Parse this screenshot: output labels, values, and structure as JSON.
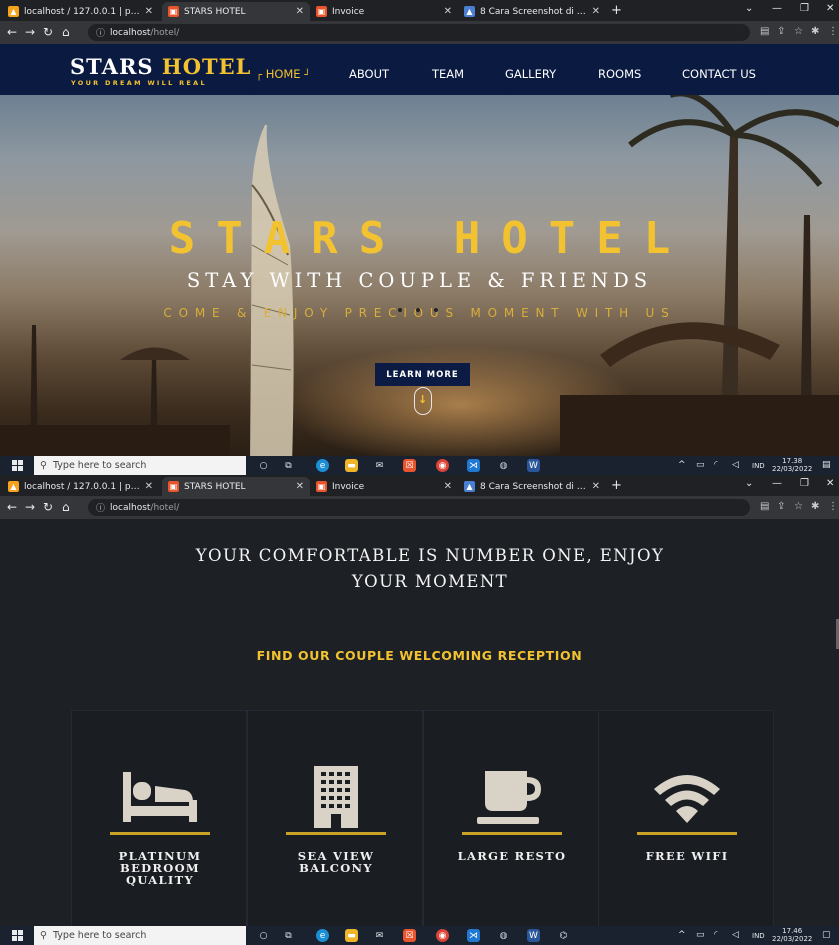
{
  "window1": {
    "tabs": [
      {
        "label": "localhost / 127.0.0.1 | phpMyAdmin",
        "favicon": "phpmyadmin-icon",
        "color": "#f7a21b",
        "active": false
      },
      {
        "label": "STARS HOTEL",
        "favicon": "hotel-icon",
        "color": "#e8542c",
        "active": true
      },
      {
        "label": "Invoice",
        "favicon": "hotel-icon",
        "color": "#e8542c",
        "active": false
      },
      {
        "label": "8 Cara Screenshot di Laptop Windows",
        "favicon": "article-icon",
        "color": "#4a7fd4",
        "active": false
      }
    ],
    "url_host": "localhost",
    "url_path": "/hotel/"
  },
  "hotel": {
    "brand_main": "STARS",
    "brand_accent": "HOTEL",
    "tagline": "YOUR DREAM WILL REAL",
    "nav": [
      "HOME",
      "ABOUT",
      "TEAM",
      "GALLERY",
      "ROOMS",
      "CONTACT US"
    ],
    "hero_title": "STARS HOTEL",
    "hero_subtitle": "STAY WITH COUPLE & FRIENDS",
    "hero_tagline": "COME & ENJOY PRECIOUS MOMENT WITH US",
    "cta": "LEARN MORE",
    "scroll_arrow": "↓"
  },
  "taskbar1": {
    "search_placeholder": "Type here to search",
    "lang": "IND",
    "time": "17.38",
    "date": "22/03/2022"
  },
  "taskbar2": {
    "search_placeholder": "Type here to search",
    "lang": "IND",
    "time": "17.46",
    "date": "22/03/2022"
  },
  "section2": {
    "title": "YOUR COMFORTABLE IS NUMBER ONE, ENJOY YOUR MOMENT",
    "subtitle": "FIND OUR COUPLE WELCOMING RECEPTION",
    "features": [
      {
        "label": "PLATINUM BEDROOM QUALITY",
        "icon": "bed-icon"
      },
      {
        "label": "SEA VIEW BALCONY",
        "icon": "building-icon"
      },
      {
        "label": "LARGE RESTO",
        "icon": "coffee-cup-icon"
      },
      {
        "label": "FREE WIFI",
        "icon": "wifi-icon"
      }
    ]
  },
  "colors": {
    "gold": "#f2c230",
    "navy": "#0a1a40",
    "dark": "#1d2025"
  }
}
